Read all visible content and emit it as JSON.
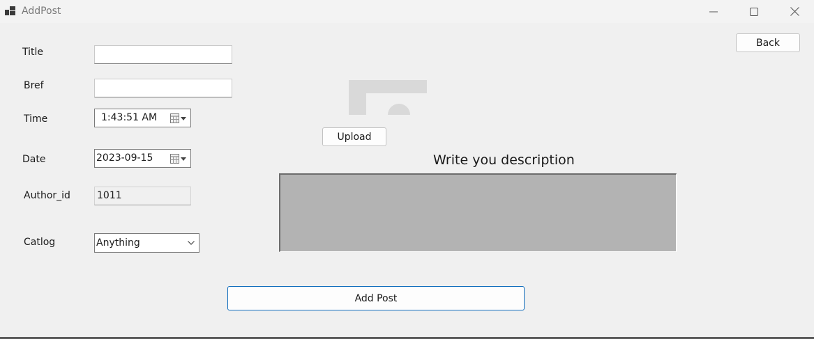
{
  "window": {
    "title": "AddPost",
    "icon": "app-window-icon",
    "controls": [
      "minimize-icon",
      "maximize-icon",
      "close-icon"
    ]
  },
  "form": {
    "title": {
      "label": "Title",
      "value": ""
    },
    "bref": {
      "label": "Bref",
      "value": ""
    },
    "time": {
      "label": "Time",
      "value": "1:43:51 AM"
    },
    "date": {
      "label": "Date",
      "value": "2023-09-15"
    },
    "author_id": {
      "label": "Author_id",
      "value": "1011"
    },
    "catlog": {
      "label": "Catlog",
      "selected": "Anything"
    }
  },
  "buttons": {
    "back": "Back",
    "upload": "Upload",
    "add_post": "Add Post"
  },
  "description": {
    "heading": "Write you description",
    "value": ""
  },
  "colors": {
    "background": "#f0f0f0",
    "description_box": "#b3b3b3",
    "primary_border": "#0f6cbd"
  }
}
